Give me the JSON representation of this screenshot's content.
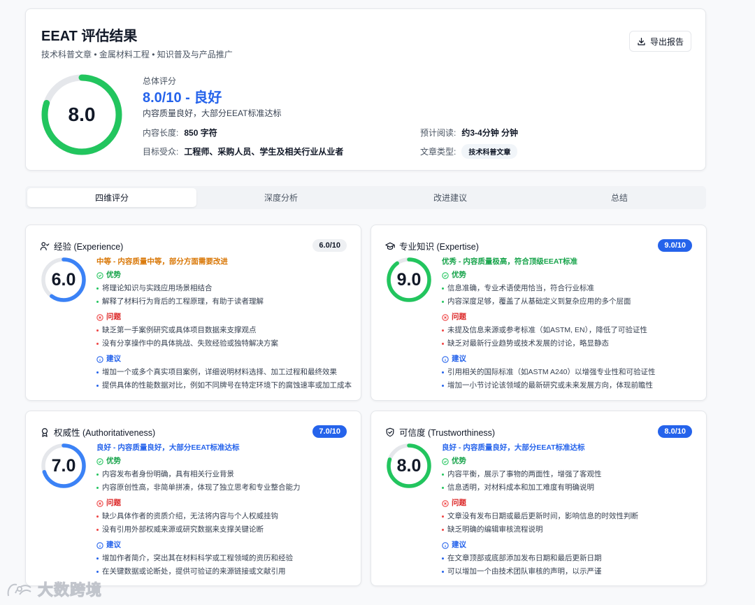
{
  "header": {
    "title": "EEAT 评估结果",
    "tags": "技术科普文章 • 金属材料工程 • 知识普及与产品推广",
    "export_label": "导出报告",
    "overall_score": 8.0,
    "overall_score_text": "8.0",
    "overall_label": "总体评分",
    "overall_value": "8.0/10 - 良好",
    "overall_desc": "内容质量良好，大部分EEAT标准达标",
    "length_label": "内容长度:",
    "length_value": "850 字符",
    "audience_label": "目标受众:",
    "audience_value": "工程师、采购人员、学生及相关行业从业者",
    "reading_label": "预计阅读:",
    "reading_value": "约3-4分钟 分钟",
    "type_label": "文章类型:",
    "type_value": "技术科普文章"
  },
  "tabs": [
    {
      "label": "四维评分",
      "active": true
    },
    {
      "label": "深度分析",
      "active": false
    },
    {
      "label": "改进建议",
      "active": false
    },
    {
      "label": "总结",
      "active": false
    }
  ],
  "colors": {
    "accent_blue": "#2563eb",
    "success_green": "#22c55e",
    "warning_orange": "#d97706",
    "danger_red": "#ef4444"
  },
  "dimensions": [
    {
      "icon": "user-icon",
      "title": "经验 (Experience)",
      "badge": "6.0/10",
      "badge_style": "grey",
      "score": 6.0,
      "score_text": "6.0",
      "ring_color": "#3b82f6",
      "verdict": "中等 - 内容质量中等，部分方面需要改进",
      "verdict_color": "#d97706",
      "strengths_label": "优势",
      "strengths": [
        "将理论知识与实践应用场景相结合",
        "解释了材料行为背后的工程原理，有助于读者理解"
      ],
      "issues_label": "问题",
      "issues": [
        "缺乏第一手案例研究或具体项目数据来支撑观点",
        "没有分享操作中的具体挑战、失败经验或独特解决方案"
      ],
      "suggestions_label": "建议",
      "suggestions": [
        "增加一个或多个真实项目案例，详细说明材料选择、加工过程和最终效果",
        "提供具体的性能数据对比，例如不同牌号在特定环境下的腐蚀速率或加工成本"
      ]
    },
    {
      "icon": "graduation-cap-icon",
      "title": "专业知识 (Expertise)",
      "badge": "9.0/10",
      "badge_style": "blue",
      "score": 9.0,
      "score_text": "9.0",
      "ring_color": "#22c55e",
      "verdict": "优秀 - 内容质量极高，符合顶级EEAT标准",
      "verdict_color": "#16a34a",
      "strengths_label": "优势",
      "strengths": [
        "信息准确，专业术语使用恰当，符合行业标准",
        "内容深度足够，覆盖了从基础定义到复杂应用的多个层面"
      ],
      "issues_label": "问题",
      "issues": [
        "未提及信息来源或参考标准（如ASTM, EN），降低了可验证性",
        "缺乏对最新行业趋势或技术发展的讨论，略显静态"
      ],
      "suggestions_label": "建议",
      "suggestions": [
        "引用相关的国际标准（如ASTM A240）以增强专业性和可验证性",
        "增加一小节讨论该领域的最新研究或未来发展方向，体现前瞻性"
      ]
    },
    {
      "icon": "award-icon",
      "title": "权威性 (Authoritativeness)",
      "badge": "7.0/10",
      "badge_style": "blue",
      "score": 7.0,
      "score_text": "7.0",
      "ring_color": "#3b82f6",
      "verdict": "良好 - 内容质量良好，大部分EEAT标准达标",
      "verdict_color": "#2563eb",
      "strengths_label": "优势",
      "strengths": [
        "内容发布者身份明确，具有相关行业背景",
        "内容原创性高，非简单拼凑，体现了独立思考和专业整合能力"
      ],
      "issues_label": "问题",
      "issues": [
        "缺少具体作者的资质介绍，无法将内容与个人权威挂钩",
        "没有引用外部权威来源或研究数据来支撑关键论断"
      ],
      "suggestions_label": "建议",
      "suggestions": [
        "增加作者简介，突出其在材料科学或工程领域的资历和经验",
        "在关键数据或论断处，提供可验证的来源链接或文献引用"
      ]
    },
    {
      "icon": "shield-check-icon",
      "title": "可信度 (Trustworthiness)",
      "badge": "8.0/10",
      "badge_style": "blue",
      "score": 8.0,
      "score_text": "8.0",
      "ring_color": "#22c55e",
      "verdict": "良好 - 内容质量良好，大部分EEAT标准达标",
      "verdict_color": "#2563eb",
      "strengths_label": "优势",
      "strengths": [
        "内容平衡，展示了事物的两面性，增强了客观性",
        "信息透明，对材料成本和加工难度有明确说明"
      ],
      "issues_label": "问题",
      "issues": [
        "文章没有发布日期或最后更新时间，影响信息的时效性判断",
        "缺乏明确的编辑审核流程说明"
      ],
      "suggestions_label": "建议",
      "suggestions": [
        "在文章顶部或底部添加发布日期和最后更新日期",
        "可以增加一个由技术团队审核的声明，以示严谨"
      ]
    }
  ],
  "watermark": "大数跨境"
}
